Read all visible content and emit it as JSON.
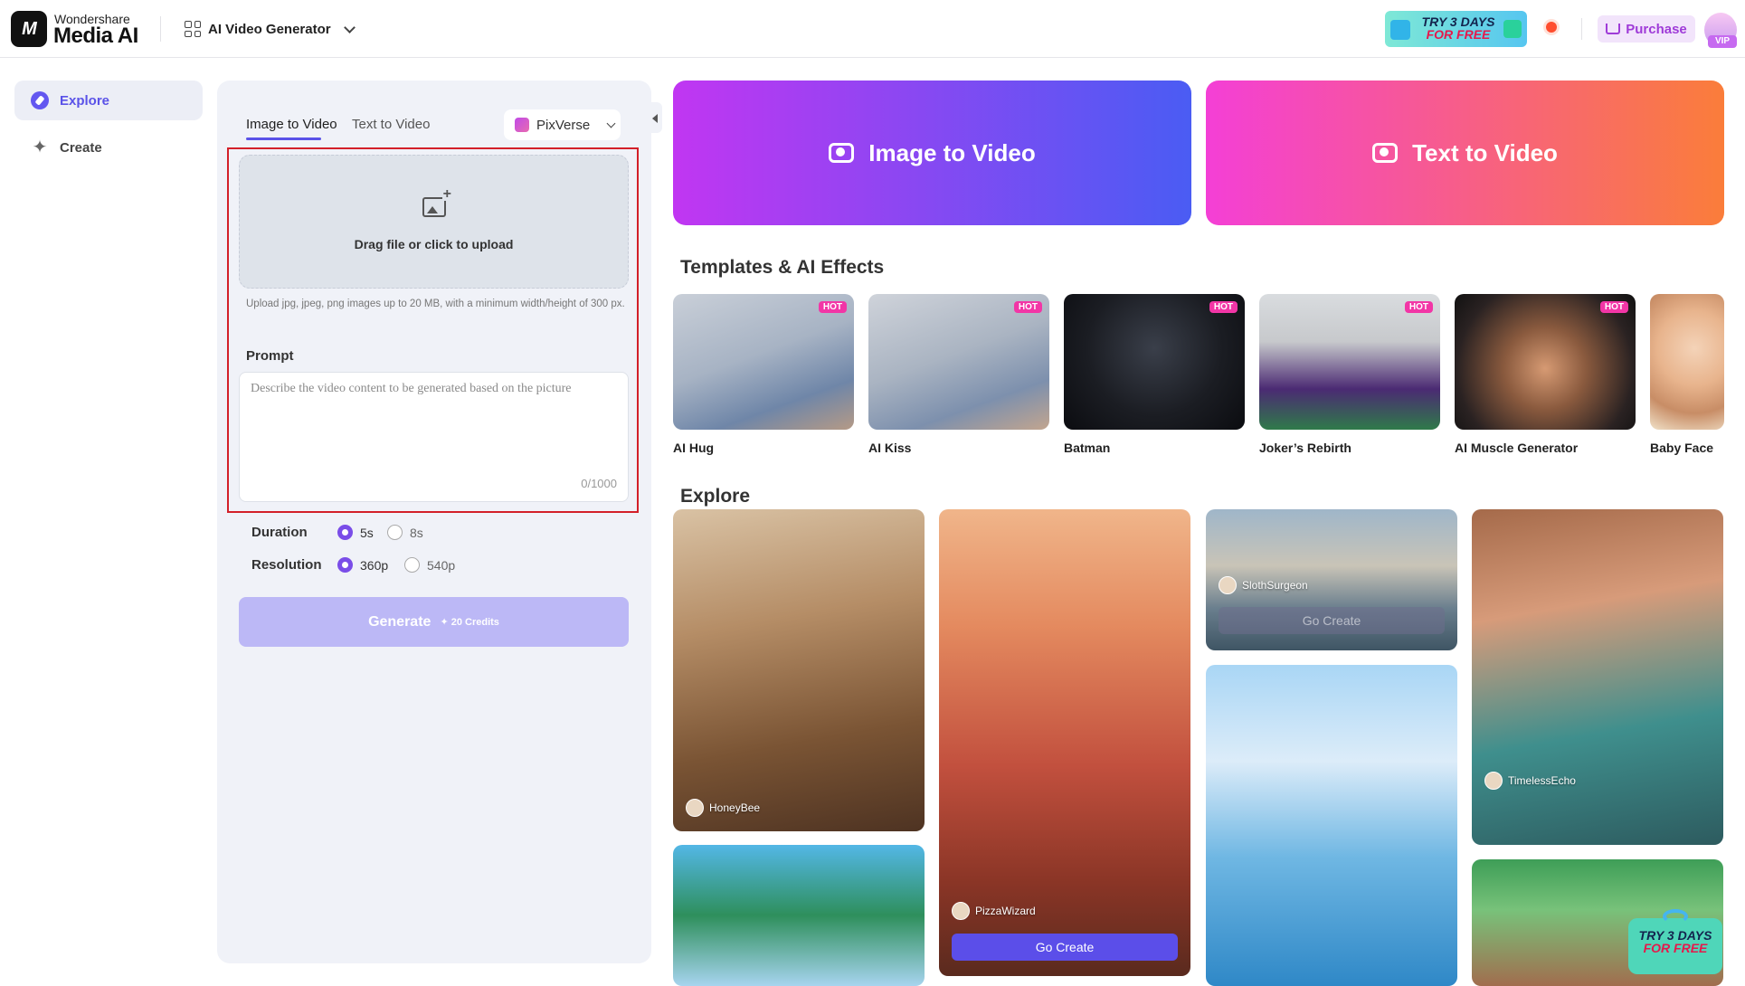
{
  "header": {
    "brand_top": "Wondershare",
    "brand_main": "Media AI",
    "logo_text": "M",
    "product": "AI Video Generator",
    "promo_line1": "TRY 3 DAYS",
    "promo_line2": "FOR FREE",
    "purchase_label": "Purchase",
    "vip_label": "VIP"
  },
  "sidebar": {
    "items": [
      {
        "label": "Explore",
        "active": true,
        "icon": "compass-icon"
      },
      {
        "label": "Create",
        "active": false,
        "icon": "sparkle-icon"
      }
    ]
  },
  "panel": {
    "tabs": [
      {
        "label": "Image to Video",
        "active": true
      },
      {
        "label": "Text to Video",
        "active": false
      }
    ],
    "model": "PixVerse",
    "upload_label": "Drag file or click to upload",
    "upload_hint": "Upload jpg, jpeg, png images up to 20 MB, with a minimum width/height of 300 px.",
    "prompt_label": "Prompt",
    "prompt_placeholder": "Describe the video content to be generated based on the picture",
    "prompt_counter": "0/1000",
    "duration_label": "Duration",
    "duration_options": [
      "5s",
      "8s"
    ],
    "duration_selected": "5s",
    "resolution_label": "Resolution",
    "resolution_options": [
      "360p",
      "540p"
    ],
    "resolution_selected": "360p",
    "generate_label": "Generate",
    "generate_credits": "20 Credits"
  },
  "hero": {
    "image_to_video": "Image to Video",
    "text_to_video": "Text to Video"
  },
  "templates": {
    "title": "Templates & AI Effects",
    "hot_label": "HOT",
    "items": [
      {
        "name": "AI Hug",
        "hot": true
      },
      {
        "name": "AI Kiss",
        "hot": true
      },
      {
        "name": "Batman",
        "hot": true
      },
      {
        "name": "Joker’s Rebirth",
        "hot": true
      },
      {
        "name": "AI Muscle Generator",
        "hot": true
      },
      {
        "name": "Baby Face",
        "hot": false
      }
    ]
  },
  "explore": {
    "title": "Explore",
    "go_create": "Go Create",
    "cards": [
      {
        "user": "HoneyBee"
      },
      {
        "user": "PizzaWizard"
      },
      {
        "user": "SlothSurgeon"
      },
      {
        "user": "TimelessEcho"
      }
    ]
  },
  "colors": {
    "accent": "#5a52e8",
    "hot": "#f236a6",
    "highlight": "#d32029"
  }
}
